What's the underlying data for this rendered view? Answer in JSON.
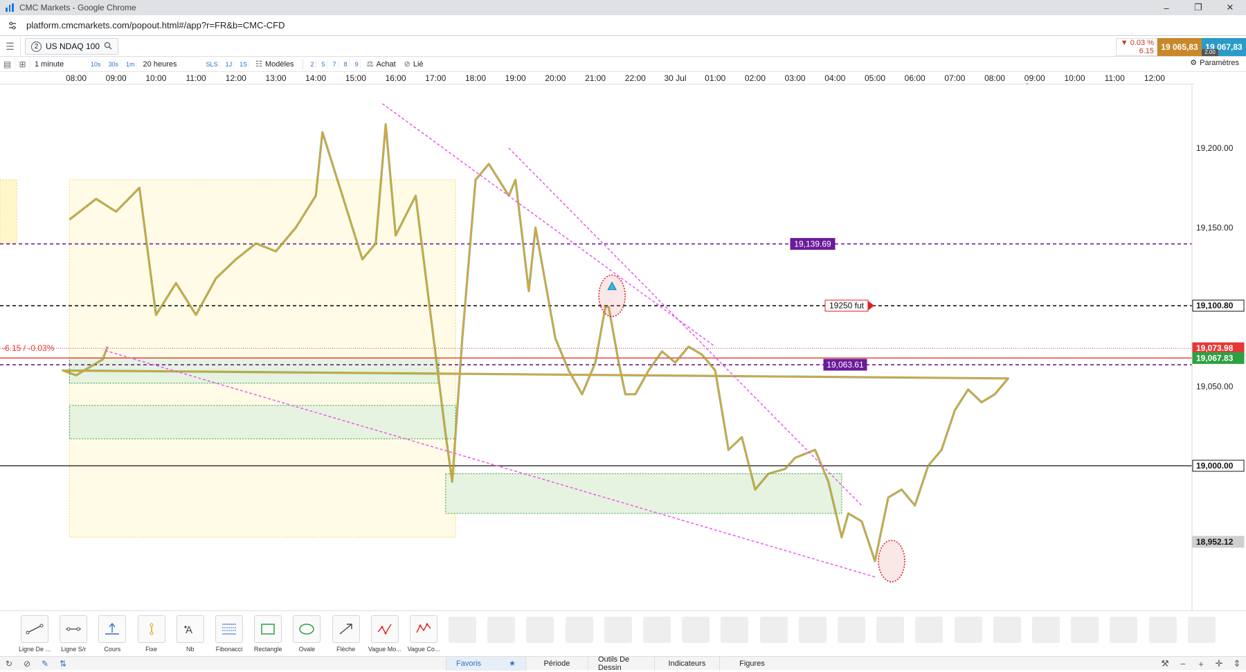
{
  "window": {
    "title": "CMC Markets - Google Chrome",
    "controls": [
      "–",
      "❐",
      "✕"
    ]
  },
  "browser": {
    "url": "platform.cmcmarkets.com/popout.html#/app?r=FR&b=CMC-CFD"
  },
  "instrument": {
    "count": "2",
    "name": "US NDAQ 100"
  },
  "quote": {
    "change_pct": "▼ 0.03 %",
    "change_pts": "6.15",
    "sell": "19 065,83",
    "buy": "19 067,83",
    "spread": "2.00"
  },
  "toolbar": {
    "interval": "1 minute",
    "quick_intervals": [
      "10s",
      "30s",
      "1m"
    ],
    "range": "20 heures",
    "range_chips": [
      "SLS",
      "1J",
      "1S"
    ],
    "templates": "Modèles",
    "template_chips": [
      "2",
      "5",
      "7",
      "8",
      "9"
    ],
    "buy": "Achat",
    "linked": "Lié",
    "settings": "Paramètres"
  },
  "time_axis": [
    "08:00",
    "09:00",
    "10:00",
    "11:00",
    "12:00",
    "13:00",
    "14:00",
    "15:00",
    "16:00",
    "17:00",
    "18:00",
    "19:00",
    "20:00",
    "21:00",
    "22:00",
    "30 Jul",
    "01:00",
    "02:00",
    "03:00",
    "04:00",
    "05:00",
    "06:00",
    "07:00",
    "08:00",
    "09:00",
    "10:00",
    "11:00",
    "12:00"
  ],
  "chart_data": {
    "type": "line",
    "instrument": "US NDAQ 100",
    "interval": "1 minute",
    "y_ticks": [
      "19,200.00",
      "19,150.00",
      "19,050.00",
      "19,000.00"
    ],
    "ylim": [
      18920,
      19228
    ],
    "price_path": {
      "x": [
        "07:50",
        "08:30",
        "09:00",
        "09:35",
        "10:00",
        "10:30",
        "11:00",
        "11:30",
        "12:00",
        "12:30",
        "13:00",
        "13:30",
        "14:00",
        "14:10",
        "14:40",
        "15:10",
        "15:30",
        "15:45",
        "16:00",
        "16:30",
        "17:00",
        "17:15",
        "17:25",
        "17:40",
        "17:50",
        "18:00",
        "18:20",
        "18:50",
        "19:00",
        "19:20",
        "19:30",
        "20:00",
        "20:20",
        "20:40",
        "21:00",
        "21:15",
        "21:20",
        "21:35",
        "21:45",
        "22:00",
        "22:20",
        "22:40",
        "23:00",
        "23:20",
        "23:40",
        "00:00",
        "00:20",
        "00:40",
        "01:00",
        "01:20",
        "01:45",
        "02:00",
        "02:30",
        "02:50",
        "03:10",
        "03:20",
        "03:40",
        "04:00",
        "04:20",
        "04:40",
        "05:00",
        "05:20",
        "05:40",
        "06:00",
        "06:20",
        "06:40",
        "07:00",
        "07:20",
        "07:40",
        "08:00",
        "08:20",
        "08:40",
        "08:47"
      ],
      "y": [
        19155,
        19168,
        19160,
        19175,
        19095,
        19115,
        19095,
        19118,
        19130,
        19140,
        19135,
        19150,
        19170,
        19210,
        19170,
        19130,
        19140,
        19215,
        19145,
        19170,
        19070,
        19020,
        18990,
        19080,
        19130,
        19180,
        19190,
        19170,
        19180,
        19110,
        19150,
        19080,
        19060,
        19045,
        19065,
        19100,
        19100,
        19065,
        19045,
        19045,
        19060,
        19072,
        19065,
        19075,
        19070,
        19060,
        19010,
        19018,
        18985,
        18995,
        18998,
        19005,
        19010,
        18990,
        18955,
        18970,
        18965,
        18940,
        18980,
        18985,
        18975,
        19000,
        19010,
        19035,
        19048,
        19040,
        19045,
        19055,
        19060,
        19057,
        19062,
        19067,
        19075
      ]
    },
    "horizontal_levels": [
      {
        "value": 19139.69,
        "label": "19,139.69",
        "style": "dashed",
        "color": "#6a1b9a"
      },
      {
        "value": 19100.8,
        "label": "19250 fut",
        "axis_label": "19,100.80",
        "style": "dashed",
        "color": "#111111"
      },
      {
        "value": 19063.61,
        "label": "19,063.61",
        "style": "dashed",
        "color": "#6a1b9a"
      },
      {
        "value": 19000.0,
        "axis_label": "19,000.00",
        "style": "solid",
        "color": "#111111"
      },
      {
        "value": 19073.98,
        "axis_label": "19,073.98",
        "style": "dotted",
        "color": "#e53935"
      },
      {
        "value": 19067.83,
        "axis_label": "19,067.83",
        "style": "solid",
        "color": "#e53935"
      },
      {
        "value": 18952.12,
        "axis_label": "18,952.12",
        "style": "none",
        "color": "#555555"
      }
    ],
    "change_annotation": "-6.15 / -0.03%",
    "zones": [
      {
        "kind": "yellow-session",
        "y_range": [
          18955,
          19180
        ],
        "x_range": [
          "07:50",
          "17:30"
        ]
      },
      {
        "kind": "green-supply",
        "y_range": [
          19052,
          19068
        ],
        "x_range": [
          "07:50",
          "17:05"
        ]
      },
      {
        "kind": "green-supply",
        "y_range": [
          19017,
          19038
        ],
        "x_range": [
          "07:50",
          "17:30"
        ]
      },
      {
        "kind": "green-demand",
        "y_range": [
          18970,
          18995
        ],
        "x_range": [
          "17:15",
          "03:10"
        ]
      }
    ],
    "trendlines": [
      {
        "from": [
          "15:40",
          19228
        ],
        "to": [
          "00:00",
          19075
        ]
      },
      {
        "from": [
          "18:50",
          19200
        ],
        "to": [
          "03:40",
          18975
        ]
      },
      {
        "from": [
          "04:00",
          18930
        ],
        "to": [
          "08:40",
          19073
        ]
      }
    ],
    "markers": [
      {
        "kind": "ellipse-red",
        "at": [
          "21:25",
          19107
        ]
      },
      {
        "kind": "ellipse-red",
        "at": [
          "04:25",
          18940
        ]
      },
      {
        "kind": "triangle-up-blue",
        "at": [
          "21:25",
          19113
        ]
      }
    ],
    "colors": {
      "price": "#f0a01e",
      "price_dark": "#1f7a3a",
      "trend": "#ee55ee",
      "yellow_zone": "#fffbe6",
      "green_zone": "#e6f3e0"
    },
    "grid": false
  },
  "drawing_tools": [
    {
      "label": "Ligne De ...",
      "icon": "trend-line-icon"
    },
    {
      "label": "Ligne S/r",
      "icon": "sr-line-icon"
    },
    {
      "label": "Cours",
      "icon": "price-marker-icon"
    },
    {
      "label": "Fixe",
      "icon": "fixed-line-icon"
    },
    {
      "label": "Nb",
      "icon": "text-note-icon"
    },
    {
      "label": "Fibonacci",
      "icon": "fibonacci-icon"
    },
    {
      "label": "Rectangle",
      "icon": "rectangle-icon"
    },
    {
      "label": "Ovale",
      "icon": "oval-icon"
    },
    {
      "label": "Flèche",
      "icon": "arrow-icon"
    },
    {
      "label": "Vague Mo...",
      "icon": "wave-icon"
    },
    {
      "label": "Vague Co...",
      "icon": "corrective-wave-icon"
    }
  ],
  "bottom_tabs": [
    "Favoris",
    "Période",
    "Outils De Dessin",
    "Indicateurs",
    "Figures"
  ]
}
